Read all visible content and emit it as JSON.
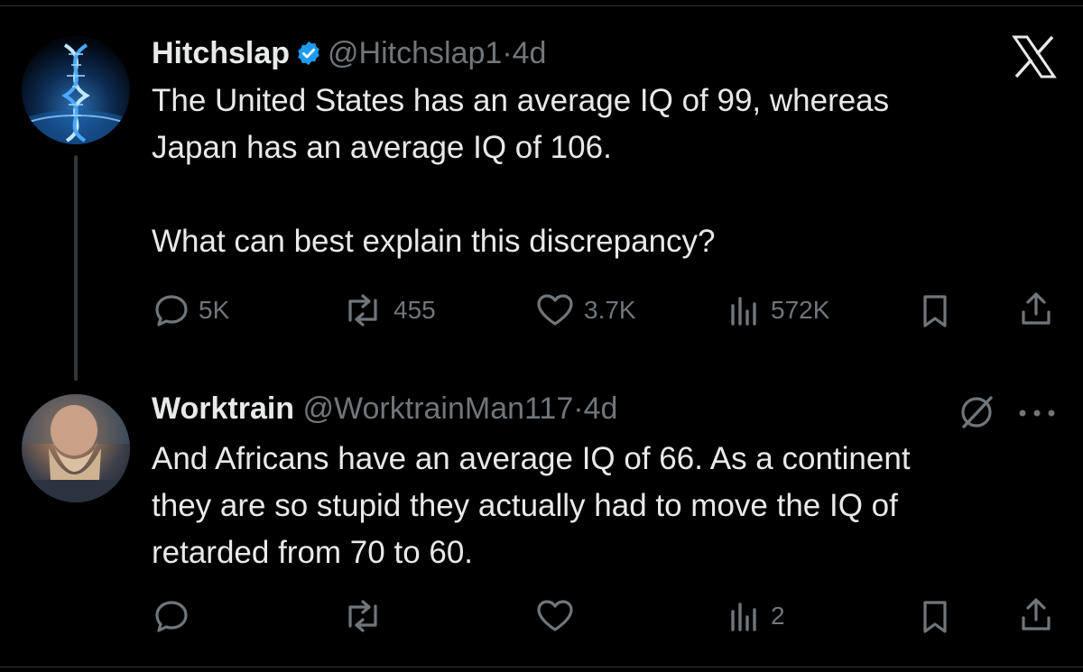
{
  "brand": {
    "logo_icon": "x-logo-icon"
  },
  "colors": {
    "background": "#000000",
    "text": "#e7e9ea",
    "muted": "#71767b",
    "verified": "#1d9bf0"
  },
  "tweet1": {
    "name": "Hitchslap",
    "handle": "@Hitchslap1",
    "separator": "·",
    "time": "4d",
    "verified": true,
    "text": "The United States has an average IQ of 99, whereas\nJapan has an average IQ of 106.\n\nWhat can best explain this discrepancy?",
    "actions": {
      "replies": "5K",
      "reposts": "455",
      "likes": "3.7K",
      "views": "572K"
    }
  },
  "tweet2": {
    "name": "Worktrain",
    "handle": "@WorktrainMan117",
    "separator": "·",
    "time": "4d",
    "text": "And Africans have an average IQ of 66. As a continent\nthey are so stupid they actually had to move the IQ of\nretarded from 70 to 60.",
    "actions": {
      "replies": "",
      "reposts": "",
      "likes": "",
      "views": "2"
    }
  }
}
